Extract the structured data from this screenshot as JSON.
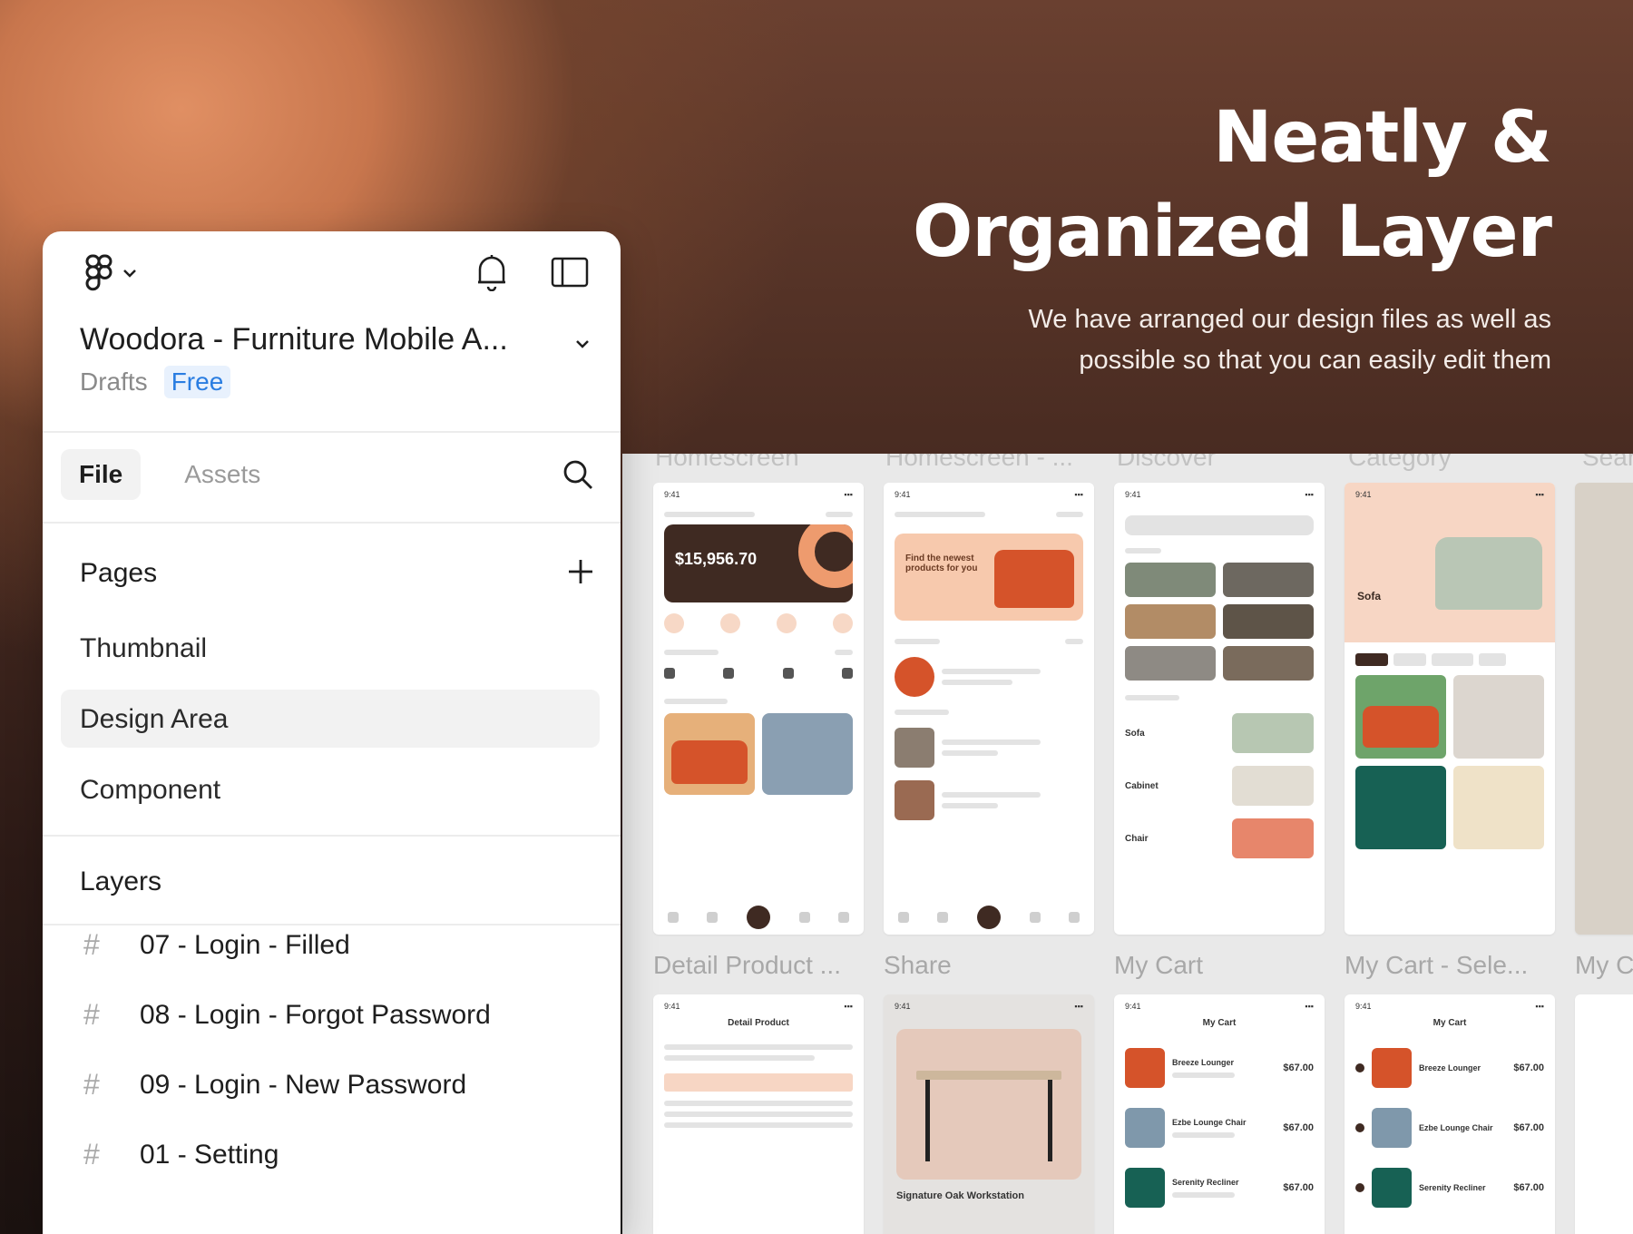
{
  "headline": {
    "line1": "Neatly &",
    "line2": "Organized Layer",
    "subtitle": "We have arranged our design files as well as possible so that you can easily edit them"
  },
  "panel": {
    "file_title": "Woodora - Furniture Mobile A...",
    "location": "Drafts",
    "plan_badge": "Free",
    "tabs": [
      "File",
      "Assets"
    ],
    "pages_heading": "Pages",
    "pages": [
      "Thumbnail",
      "Design Area",
      "Component"
    ],
    "selected_page": "Design Area",
    "layers_heading": "Layers",
    "layers": [
      "07 - Login - Filled",
      "08 - Login - Forgot Password",
      "09 - Login - New Password",
      "01 - Setting"
    ]
  },
  "canvas": {
    "row1_labels": [
      "Homescreen",
      "Homescreen - ...",
      "Discover",
      "Category",
      "Sear"
    ],
    "row2_labels": [
      "Detail Product ...",
      "Share",
      "My Cart",
      "My Cart - Sele...",
      "My C"
    ],
    "frames": {
      "home_balance": "$15,956.70",
      "promo_text": "Find the newest products for you",
      "sofa_title": "Sofa",
      "detail_title": "Detail Product",
      "share_product": "Signature Oak Workstation",
      "cart_title": "My Cart",
      "cart_items": [
        "Breeze Lounger",
        "Ezbe Lounge Chair",
        "Serenity Recliner"
      ],
      "cart_price": "$67.00",
      "discover_categories": [
        "Sofa",
        "Cabinet",
        "Chair"
      ]
    }
  },
  "colors": {
    "accent": "#3f2a22",
    "orange": "#d5532a",
    "peach": "#f7c9ad",
    "badge_bg": "#e8f1fd",
    "badge_text": "#2a7de1"
  },
  "icons": [
    "figma-logo-icon",
    "chevron-down-icon",
    "bell-icon",
    "sidebar-toggle-icon",
    "search-icon",
    "plus-icon",
    "frame-hash-icon"
  ]
}
